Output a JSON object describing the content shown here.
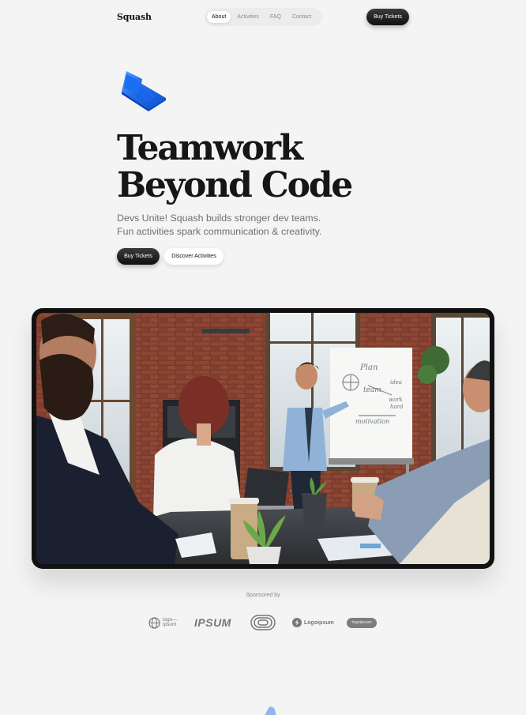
{
  "brand": {
    "name": "Squash",
    "accent": "#1a6ef5",
    "dark": "#121212"
  },
  "nav": {
    "links": [
      {
        "label": "About",
        "active": true
      },
      {
        "label": "Activities",
        "active": false
      },
      {
        "label": "FAQ",
        "active": false
      },
      {
        "label": "Contact",
        "active": false
      }
    ],
    "cta_label": "Buy Tickets"
  },
  "hero": {
    "icon": "laptop-icon",
    "headline_line1": "Teamwork",
    "headline_line2": "Beyond Code",
    "sub_line1": "Devs Unite! Squash builds stronger dev teams.",
    "sub_line2": "Fun activities spark communication & creativity.",
    "primary_label": "Buy Tickets",
    "secondary_label": "Discover Activities"
  },
  "showcase": {
    "whiteboard_words": [
      "Plan",
      "idea",
      "team",
      "work",
      "hard",
      "motivation"
    ]
  },
  "sponsors": {
    "label": "Sponsored by",
    "logos": [
      {
        "icon": "globe-icon",
        "line1": "logo—",
        "line2": "ipsum"
      },
      {
        "text": "IPSUM"
      },
      {
        "icon": "rings-icon"
      },
      {
        "icon": "bolt-icon",
        "text": "Logoipsum"
      },
      {
        "text": "logoipsum"
      }
    ]
  }
}
